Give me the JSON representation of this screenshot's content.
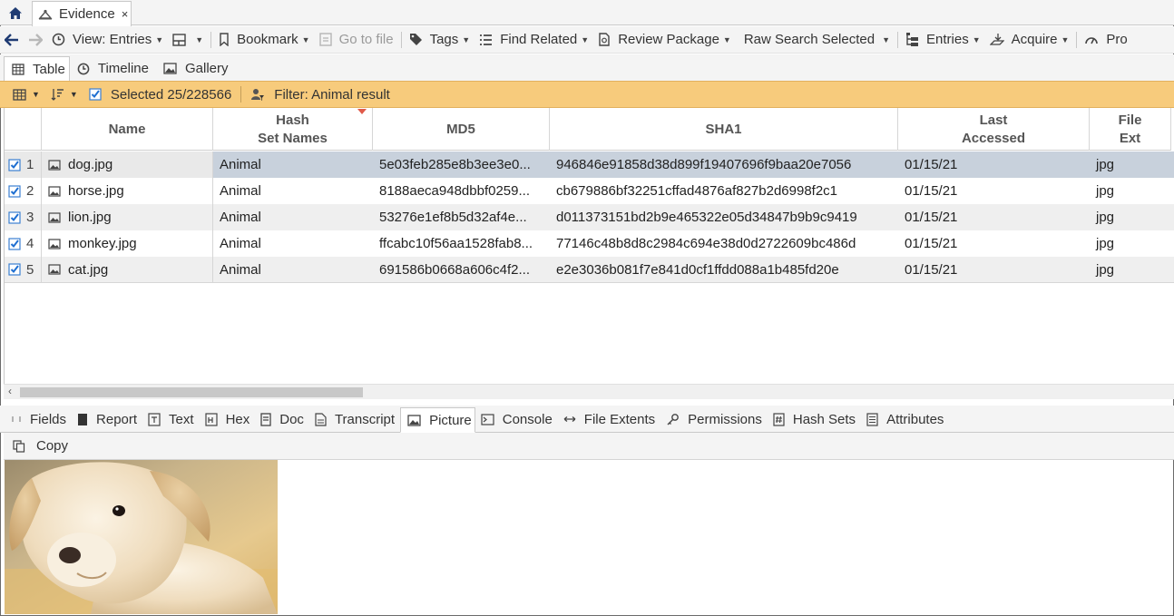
{
  "top_tabs": {
    "home_icon": "home-icon",
    "evidence_tab": {
      "label": "Evidence",
      "close": "×"
    }
  },
  "toolbar": {
    "view_entries": "View: Entries",
    "bookmark": "Bookmark",
    "go_to_file": "Go to file",
    "tags": "Tags",
    "find_related": "Find Related",
    "review_package": "Review Package",
    "raw_search_selected": "Raw Search Selected",
    "entries": "Entries",
    "acquire": "Acquire",
    "pro": "Pro"
  },
  "view_tabs": {
    "table": "Table",
    "timeline": "Timeline",
    "gallery": "Gallery"
  },
  "filter_bar": {
    "selected": "Selected 25/228566",
    "filter": "Filter: Animal result",
    "color": "#f7cb7c"
  },
  "table": {
    "headers": {
      "name": "Name",
      "hash_set_names_1": "Hash",
      "hash_set_names_2": "Set Names",
      "md5": "MD5",
      "sha1": "SHA1",
      "last_accessed_1": "Last",
      "last_accessed_2": "Accessed",
      "file_ext_1": "File",
      "file_ext_2": "Ext"
    },
    "rows": [
      {
        "n": "1",
        "name": "dog.jpg",
        "hash_set": "Animal",
        "md5": "5e03feb285e8b3ee3e0...",
        "sha1": "946846e91858d38d899f19407696f9baa20e7056",
        "last_accessed": "01/15/21",
        "ext": "jpg"
      },
      {
        "n": "2",
        "name": "horse.jpg",
        "hash_set": "Animal",
        "md5": "8188aeca948dbbf0259...",
        "sha1": "cb679886bf32251cffad4876af827b2d6998f2c1",
        "last_accessed": "01/15/21",
        "ext": "jpg"
      },
      {
        "n": "3",
        "name": "lion.jpg",
        "hash_set": "Animal",
        "md5": "53276e1ef8b5d32af4e...",
        "sha1": "d011373151bd2b9e465322e05d34847b9b9c9419",
        "last_accessed": "01/15/21",
        "ext": "jpg"
      },
      {
        "n": "4",
        "name": "monkey.jpg",
        "hash_set": "Animal",
        "md5": "ffcabc10f56aa1528fab8...",
        "sha1": "77146c48b8d8c2984c694e38d0d2722609bc486d",
        "last_accessed": "01/15/21",
        "ext": "jpg"
      },
      {
        "n": "5",
        "name": "cat.jpg",
        "hash_set": "Animal",
        "md5": "691586b0668a606c4f2...",
        "sha1": "e2e3036b081f7e841d0cf1ffdd088a1b485fd20e",
        "last_accessed": "01/15/21",
        "ext": "jpg"
      }
    ],
    "selected_color": "#c8d1dc"
  },
  "bottom_tabs": {
    "fields": "Fields",
    "report": "Report",
    "text": "Text",
    "hex": "Hex",
    "doc": "Doc",
    "transcript": "Transcript",
    "picture": "Picture",
    "console": "Console",
    "file_extents": "File Extents",
    "permissions": "Permissions",
    "hash_sets": "Hash Sets",
    "attributes": "Attributes"
  },
  "picture_panel": {
    "copy": "Copy",
    "image": "puppy-photo"
  }
}
